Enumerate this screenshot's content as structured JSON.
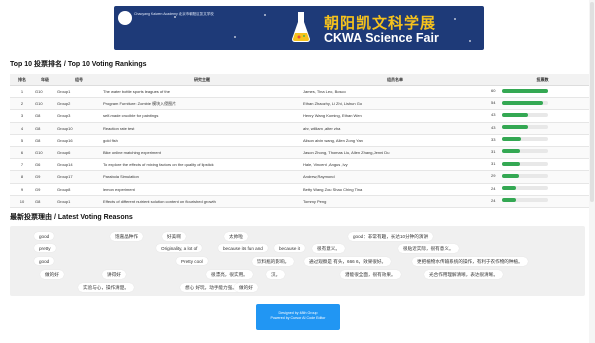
{
  "banner": {
    "sub_text": "Chaoyang Kaiwen Academy 北京市朝阳区凯文学校",
    "title_cn": "朝阳凯文科学展",
    "title_en": "CKWA Science Fair"
  },
  "top10": {
    "title": "Top 10 投票排名 / Top 10 Voting Rankings",
    "headers": [
      "排名",
      "年级",
      "组号",
      "研究主题",
      "组员名单",
      "投票数"
    ],
    "rows": [
      {
        "rank": "1",
        "grade": "G10",
        "group": "Group1",
        "topic": "The water bottle sports leagues of the",
        "members": "James, Tina Leo, Bosco",
        "votes": "60",
        "ratio": 1.0
      },
      {
        "rank": "2",
        "grade": "G10",
        "group": "Group2",
        "topic": "Program Furniture: Zombie 模块入侵图片",
        "members": "Ethan Zhaozhy, Li Zhi, Lishun Go",
        "votes": "54",
        "ratio": 0.9
      },
      {
        "rank": "3",
        "grade": "G8",
        "group": "Group3",
        "topic": "self-made crucible for paintings",
        "members": "Henry Wang Koming, Ethan Wen",
        "votes": "43",
        "ratio": 0.56
      },
      {
        "rank": "4",
        "grade": "G8",
        "group": "Group10",
        "topic": "Reaction rate test",
        "members": "ahr, william ,alter zha",
        "votes": "43",
        "ratio": 0.56
      },
      {
        "rank": "5",
        "grade": "G8",
        "group": "Group16",
        "topic": "gold fish",
        "members": "Alison alvin wang, Allen Zong Yan",
        "votes": "33",
        "ratio": 0.42
      },
      {
        "rank": "6",
        "grade": "G10",
        "group": "Group6",
        "topic": "Bike online matching experiment",
        "members": "Jason Zhong, Thomas Liu, Allen Zhang,Jenni Du",
        "votes": "31",
        "ratio": 0.4
      },
      {
        "rank": "7",
        "grade": "G6",
        "group": "Group14",
        "topic": "To explore the effects of mixing factors on the quality of lipstick",
        "members": "Hale, Vincent ,Angus ,Ivy",
        "votes": "31",
        "ratio": 0.4
      },
      {
        "rank": "8",
        "grade": "G9",
        "group": "Group17",
        "topic": "Parabola Simulation",
        "members": "Andrew,Raymond",
        "votes": "29",
        "ratio": 0.37
      },
      {
        "rank": "9",
        "grade": "G9",
        "group": "Group8",
        "topic": "lemon experiment",
        "members": "Betty Wang Zou Shao Ching Tina",
        "votes": "24",
        "ratio": 0.3
      },
      {
        "rank": "10",
        "grade": "G8",
        "group": "Group1",
        "topic": "Effects of different nutrient solution content on flourished growth",
        "members": "Tommy Peng",
        "votes": "24",
        "ratio": 0.3
      }
    ]
  },
  "reasons": {
    "title": "最新投票理由 / Latest Voting Reasons",
    "tags": [
      "good",
      "饱嘉晶种作",
      "好美啊",
      "太帅啦",
      "good：非常有趣，长达10分钟的演讲",
      "pretty",
      "Originality, a lot of",
      "because its fun and",
      "because it",
      "很有意义。",
      "很贴近实际，很有意义。",
      "good",
      "Pretty cool",
      "饮料瓶的影响。",
      "通过观察是 有头，666 6，效果很好。",
      "更把植物水传输系统的操作，有利于农作物的种植。",
      "做的好",
      "讲得好",
      "很漂亮，很实用。",
      "汉。",
      "潜能很全面，很有效果。",
      "光合作用理解清晰，表达很清晰。",
      "实验与心，操作清楚。",
      "想心 好玩，动手能力强。",
      "做的好"
    ]
  },
  "footer": {
    "line1": "Designed by 48th Group",
    "line2": "Powered by Cursor AI Code Editor"
  }
}
